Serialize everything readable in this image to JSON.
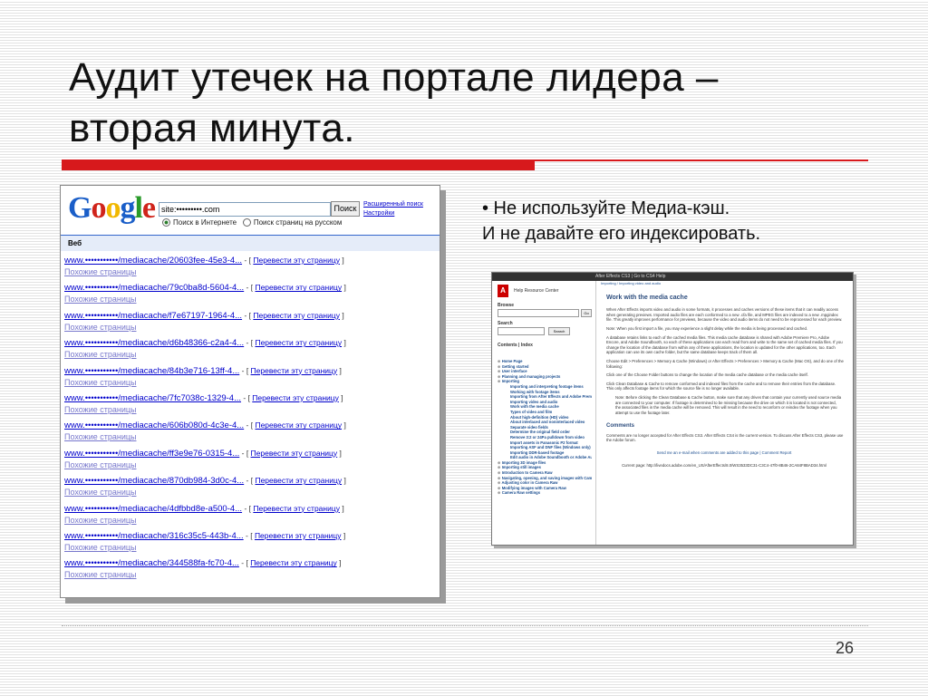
{
  "slide": {
    "title_line1": "Аудит утечек на портале лидера –",
    "title_line2": "вторая минута.",
    "bullet_line1": "• Не используйте Медиа-кэш.",
    "bullet_line2": "И не давайте его индексировать.",
    "page_number": "26",
    "accent_color": "#d7191c"
  },
  "google": {
    "logo": "Google",
    "search_value": "site:•••••••••.com",
    "search_button": "Поиск",
    "advanced_link": "Расширенный поиск",
    "settings_link": "Настройки",
    "radio_web": "Поиск в Интернете",
    "radio_ru": "Поиск страниц на русском",
    "web_tab": "Веб",
    "translate_link": "Перевести эту страницу",
    "similar_link": "Похожие страницы",
    "results": [
      "www.•••••••••••/mediacache/20603fee-45e3-4...",
      "www.•••••••••••/mediacache/79c0ba8d-5604-4...",
      "www.•••••••••••/mediacache/f7e67197-1964-4...",
      "www.•••••••••••/mediacache/d6b48366-c2a4-4...",
      "www.•••••••••••/mediacache/84b3e716-13ff-4...",
      "www.•••••••••••/mediacache/7fc7038c-1329-4...",
      "www.•••••••••••/mediacache/606b080d-4c3e-4...",
      "www.•••••••••••/mediacache/ff3e9e76-0315-4...",
      "www.•••••••••••/mediacache/870db984-3d0c-4...",
      "www.•••••••••••/mediacache/4dfbbd8e-a500-4...",
      "www.•••••••••••/mediacache/316c35c5-443b-4...",
      "www.•••••••••••/mediacache/344588fa-fc70-4..."
    ]
  },
  "adobe": {
    "topbar": "After Effects CS3 | Go to CS4 Help",
    "logo": "A",
    "help_center": "Help Resource Center",
    "browse": "Browse",
    "search": "Search",
    "search_btn": "Search",
    "go_btn": "Go",
    "contents": "Contents | Index",
    "tree": [
      {
        "t": "Home Page",
        "l": 1
      },
      {
        "t": "Getting started",
        "l": 1
      },
      {
        "t": "User interface",
        "l": 1
      },
      {
        "t": "Planning and managing projects",
        "l": 1
      },
      {
        "t": "Importing",
        "l": 1
      },
      {
        "t": "Importing and interpreting footage items",
        "l": 2
      },
      {
        "t": "Working with footage items",
        "l": 2
      },
      {
        "t": "Importing from After Effects and Adobe Premiere Pro",
        "l": 2
      },
      {
        "t": "Importing video and audio",
        "l": 2
      },
      {
        "t": "Work with the media cache",
        "l": 2
      },
      {
        "t": "Types of video and film",
        "l": 2
      },
      {
        "t": "About high-definition (HD) video",
        "l": 2
      },
      {
        "t": "About interlaced and noninterlaced video",
        "l": 2
      },
      {
        "t": "Separate video fields",
        "l": 2
      },
      {
        "t": "Determine the original field order",
        "l": 2
      },
      {
        "t": "Remove 3:2 or 24Pa pulldown from video",
        "l": 2
      },
      {
        "t": "Import assets in Panasonic P2 format",
        "l": 2
      },
      {
        "t": "Importing ASF and DNF files (Windows only)",
        "l": 2
      },
      {
        "t": "Importing DDR-based footage",
        "l": 2
      },
      {
        "t": "Edit audio in Adobe Soundbooth or Adobe Audition",
        "l": 2
      },
      {
        "t": "Importing 3D image files",
        "l": 1
      },
      {
        "t": "Importing still images",
        "l": 1
      },
      {
        "t": "Introduction to Camera Raw",
        "l": 1
      },
      {
        "t": "Navigating, opening, and saving images with Camera Raw",
        "l": 1
      },
      {
        "t": "Adjusting color in Camera Raw",
        "l": 1
      },
      {
        "t": "Modifying images with Camera Raw",
        "l": 1
      },
      {
        "t": "Camera Raw settings",
        "l": 1
      }
    ],
    "crumb": "Importing / Importing video and audio",
    "heading": "Work with the media cache",
    "p1": "When After Effects imports video and audio in some formats, it processes and caches versions of these items that it can readily access when generating previews. Imported audio files are each conformed to a new .cfa file, and MPEG files are indexed to a new .mpgindex file. This greatly improves performance for previews, because the video and audio items do not need to be reprocessed for each preview.",
    "note": "Note: When you first import a file, you may experience a slight delay while the media is being processed and cached.",
    "p2": "A database retains links to each of the cached media files. This media cache database is shared with Adobe Premiere Pro, Adobe Encore, and Adobe Soundbooth, so each of these applications can each read from and write to the same set of cached media files. If you change the location of the database from within any of these applications, the location is updated for the other applications, too. Each application can use its own cache folder, but the same database keeps track of them all.",
    "p3": "Choose Edit > Preferences > Memory & Cache (Windows) or After Effects > Preferences > Memory & Cache (Mac OS), and do one of the following:",
    "li1": "Click one of the Choose Folder buttons to change the location of the media cache database or the media cache itself.",
    "li2": "Click Clean Database & Cache to remove conformed and indexed files from the cache and to remove their entries from the database. This only affects footage items for which the source file is no longer available.",
    "note2": "Note: Before clicking the Clean Database & Cache button, make sure that any drives that contain your currently used source media are connected to your computer. If footage is determined to be missing because the drive on which it is located is not connected, the associated files in the media cache will be removed. This will result in the need to reconform or reindex the footage when you attempt to use the footage later.",
    "comments": "Comments",
    "comments_p": "Comments are no longer accepted for After Effects CS3. After Effects CS4 is the current version. To discuss After Effects CS3, please use the Adobe forum.",
    "foot_links": "Send me an e-mail when comments are added to this page | Comment Report",
    "current_page": "Current page: http://livedocs.adobe.com/en_US/AfterEffects/8.0/WS3533DC31-C3C4-47f0-8B46-2CA84F8BAD34.html"
  }
}
